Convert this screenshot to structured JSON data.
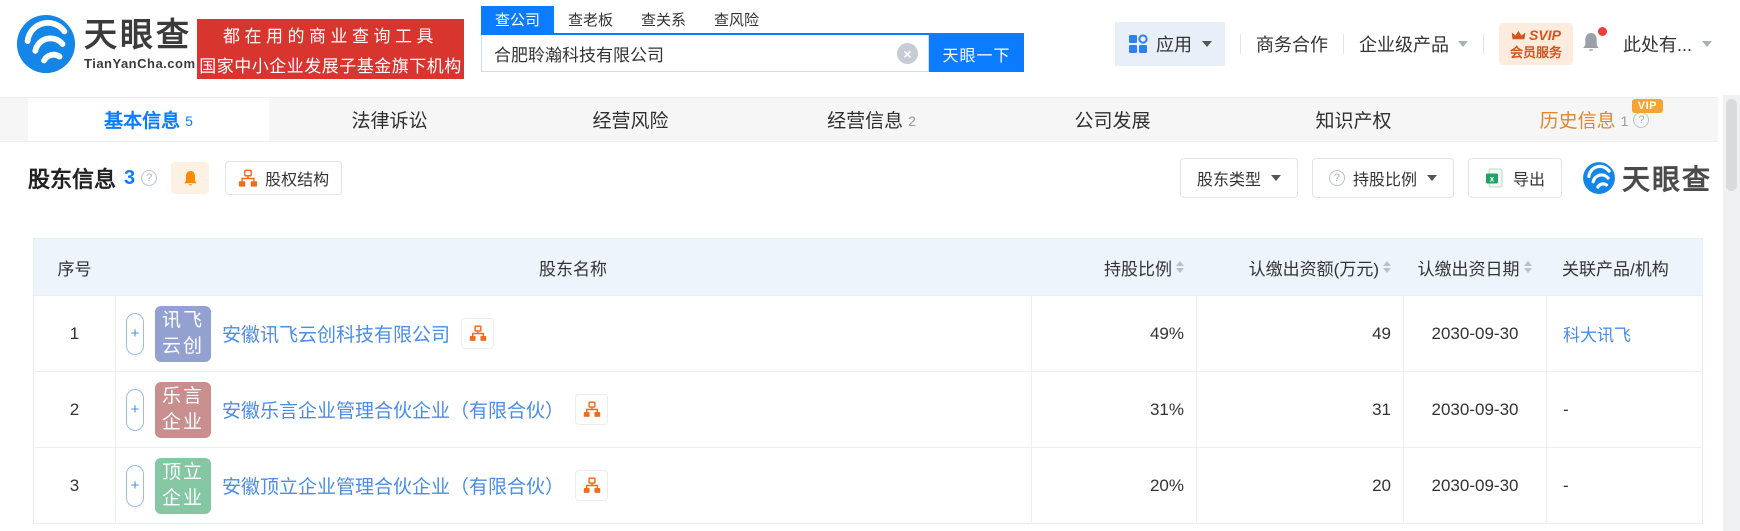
{
  "icons": {
    "plus": "+",
    "clear": "×",
    "question": "?"
  },
  "colors": {
    "brand_blue": "#0b7cff",
    "banner_red": "#d8352f",
    "link_blue": "#4a8ce8",
    "history_orange": "#e0862f",
    "vip_badge_orange": "#f5a434",
    "svip_orange": "#d4551a",
    "org_icon_orange": "#f26a1b",
    "table_header_bg": "#eef4fb"
  },
  "header": {
    "logo": {
      "title": "天眼查",
      "subtitle": "TianYanCha.com"
    },
    "banner": {
      "line1": "都在用的商业查询工具",
      "line2": "国家中小企业发展子基金旗下机构"
    },
    "search": {
      "tabs": [
        {
          "label": "查公司"
        },
        {
          "label": "查老板"
        },
        {
          "label": "查关系"
        },
        {
          "label": "查风险"
        }
      ],
      "value": "合肥聆瀚科技有限公司",
      "button_label": "天眼一下"
    },
    "nav": {
      "apps_label": "应用",
      "business_label": "商务合作",
      "enterprise_label": "企业级产品",
      "svip_line1": "SVIP",
      "svip_line2": "会员服务",
      "user_label": "此处有..."
    }
  },
  "tabs": [
    {
      "label": "基本信息",
      "count": "5"
    },
    {
      "label": "法律诉讼",
      "count": ""
    },
    {
      "label": "经营风险",
      "count": ""
    },
    {
      "label": "经营信息",
      "count": "2"
    },
    {
      "label": "公司发展",
      "count": ""
    },
    {
      "label": "知识产权",
      "count": ""
    },
    {
      "label": "历史信息",
      "count": "1",
      "vip": "VIP"
    }
  ],
  "section": {
    "title": "股东信息",
    "count": "3",
    "equity_button": "股权结构",
    "type_filter": "股东类型",
    "ratio_filter": "持股比例",
    "export_label": "导出",
    "watermark": "天眼查"
  },
  "table": {
    "headers": [
      "序号",
      "股东名称",
      "持股比例",
      "认缴出资额(万元)",
      "认缴出资日期",
      "关联产品/机构"
    ],
    "rows": [
      {
        "no": "1",
        "avatar_line1": "讯飞",
        "avatar_line2": "云创",
        "avatar_color": "#93a1d1",
        "name": "安徽讯飞云创科技有限公司",
        "ratio": "49%",
        "amount": "49",
        "date": "2030-09-30",
        "related": "科大讯飞"
      },
      {
        "no": "2",
        "avatar_line1": "乐言",
        "avatar_line2": "企业",
        "avatar_color": "#c98f8f",
        "name": "安徽乐言企业管理合伙企业（有限合伙）",
        "ratio": "31%",
        "amount": "31",
        "date": "2030-09-30",
        "related": "-"
      },
      {
        "no": "3",
        "avatar_line1": "顶立",
        "avatar_line2": "企业",
        "avatar_color": "#85c7a3",
        "name": "安徽顶立企业管理合伙企业（有限合伙）",
        "ratio": "20%",
        "amount": "20",
        "date": "2030-09-30",
        "related": "-"
      }
    ]
  }
}
